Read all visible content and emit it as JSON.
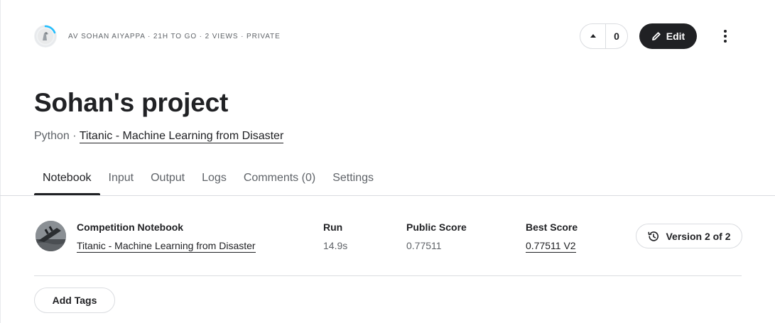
{
  "header": {
    "meta": "AV SOHAN AIYAPPA · 21H TO GO · 2 VIEWS · PRIVATE",
    "vote_count": "0",
    "edit_label": "Edit"
  },
  "notebook": {
    "title": "Sohan's project",
    "language": "Python",
    "separator": " · ",
    "competition_link": "Titanic - Machine Learning from Disaster"
  },
  "tabs": [
    {
      "label": "Notebook",
      "active": true
    },
    {
      "label": "Input"
    },
    {
      "label": "Output"
    },
    {
      "label": "Logs"
    },
    {
      "label": "Comments (0)"
    },
    {
      "label": "Settings"
    }
  ],
  "competition_row": {
    "type_label": "Competition Notebook",
    "competition_name": "Titanic - Machine Learning from Disaster",
    "run_label": "Run",
    "run_value": "14.9s",
    "public_score_label": "Public Score",
    "public_score_value": "0.77511",
    "best_score_label": "Best Score",
    "best_score_value": "0.77511 V2",
    "version_label": "Version 2 of 2"
  },
  "tags": {
    "add_label": "Add Tags"
  },
  "icons": {
    "upvote": "caret-up-icon",
    "edit": "pencil-icon",
    "more": "more-vertical-icon",
    "version": "history-icon"
  },
  "colors": {
    "primary_dark": "#202124",
    "muted_text": "#5f6368",
    "border": "#dadce0",
    "progress_ring": "#20beff"
  }
}
